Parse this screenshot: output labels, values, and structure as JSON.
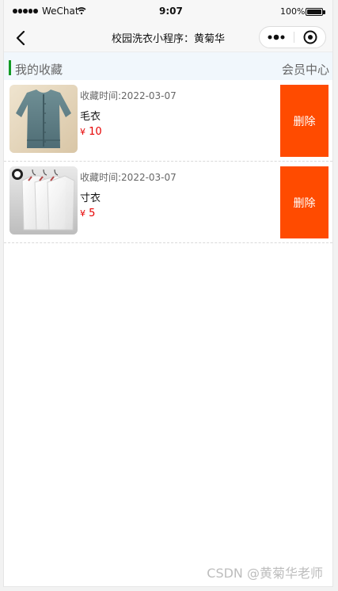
{
  "status_bar": {
    "carrier": "WeChat",
    "time": "9:07",
    "battery_percent": "100%",
    "signal_icon": "signal-icon",
    "wifi_icon": "wifi-icon"
  },
  "nav": {
    "title": "校园洗衣小程序：黄菊华",
    "back_icon": "back-arrow-icon",
    "more_icon": "more-icon",
    "close_icon": "close-icon"
  },
  "header": {
    "title": "我的收藏",
    "vip_link": "会员中心",
    "accent": "#129b25"
  },
  "items": [
    {
      "time_label": "收藏时间:2022-03-07",
      "name": "毛衣",
      "currency": "¥",
      "price": "10",
      "delete_label": "删除",
      "image_icon": "sweater-image"
    },
    {
      "time_label": "收藏时间:2022-03-07",
      "name": "寸衣",
      "currency": "¥",
      "price": "5",
      "delete_label": "删除",
      "image_icon": "shirts-image"
    }
  ],
  "colors": {
    "delete_bg": "#ff4b00",
    "price": "#e60000"
  },
  "watermark": "CSDN @黄菊华老师"
}
